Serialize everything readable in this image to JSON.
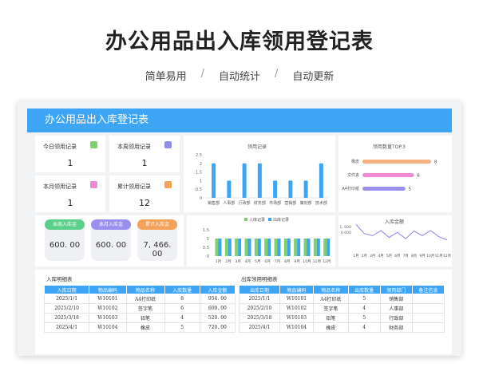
{
  "hero": {
    "title": "办公用品出入库领用登记表",
    "tags": [
      "简单易用",
      "自动统计",
      "自动更新"
    ],
    "separator": "/"
  },
  "sheet": {
    "banner_title": "办公用品出入库登记表",
    "kpis": [
      {
        "label": "今日领用记录",
        "value": "1",
        "icon_color": "#7ed16b",
        "icon": "calendar-icon"
      },
      {
        "label": "本周领用记录",
        "value": "1",
        "icon_color": "#8f8fe8",
        "icon": "document-icon"
      },
      {
        "label": "本月领用记录",
        "value": "1",
        "icon_color": "#f08ad4",
        "icon": "clock-icon"
      },
      {
        "label": "累计领用记录",
        "value": "12",
        "icon_color": "#f4a15a",
        "icon": "folder-icon"
      }
    ],
    "amounts": [
      {
        "label": "本周入库金",
        "value": "600. 00",
        "color": "#5bd08a"
      },
      {
        "label": "本月入库金",
        "value": "600. 00",
        "color": "#9b8ff0"
      },
      {
        "label": "累计入库金",
        "value": "7, 466. 00",
        "color": "#f4a15a"
      }
    ],
    "inbound_table": {
      "title": "入库明细表",
      "headers": [
        "入库日期",
        "物品编码",
        "物品名称",
        "入库数量",
        "入库金额"
      ],
      "rows": [
        [
          "2025/1/1",
          "W10101",
          "A4打印纸",
          "8",
          "954. 00"
        ],
        [
          "2025/2/10",
          "W10102",
          "签字笔",
          "6",
          "600. 00"
        ],
        [
          "2025/3/18",
          "W10103",
          "铅笔",
          "4",
          "520. 00"
        ],
        [
          "2025/4/1",
          "W10104",
          "橡皮",
          "5",
          "720. 00"
        ]
      ]
    },
    "outbound_table": {
      "title": "出库领用明细表",
      "headers": [
        "出库日期",
        "物品编码",
        "物品名称",
        "出库数量",
        "领用部门",
        "备注信息"
      ],
      "rows": [
        [
          "2025/1/1",
          "W10101",
          "A4打印纸",
          "5",
          "销售部",
          ""
        ],
        [
          "2025/2/10",
          "W10102",
          "签字笔",
          "4",
          "人事部",
          ""
        ],
        [
          "2025/3/18",
          "W10103",
          "铅笔",
          "5",
          "行政部",
          ""
        ],
        [
          "2025/4/1",
          "W10104",
          "橡皮",
          "4",
          "财务部",
          ""
        ]
      ]
    }
  },
  "chart_data": [
    {
      "type": "bar",
      "title": "领用记录",
      "categories": [
        "销售部",
        "人事部",
        "行政部",
        "财务部",
        "市场部",
        "营销部",
        "策划部",
        "技术部"
      ],
      "values": [
        2,
        1,
        2,
        2,
        1,
        1,
        1,
        2
      ],
      "ylim": [
        0,
        2.5
      ],
      "yticks": [
        "0",
        "0.5",
        "1",
        "1.5",
        "2",
        "2.5"
      ],
      "color": "#3ea4f4"
    },
    {
      "type": "bar",
      "orientation": "horizontal",
      "title": "领用数量TOP.3",
      "categories": [
        "橡皮",
        "文件夹",
        "A4打印纸"
      ],
      "values": [
        8,
        6,
        5
      ],
      "colors": [
        "#f4b080",
        "#f08ad4",
        "#9b8ff0"
      ]
    },
    {
      "type": "bar",
      "title": "",
      "series": [
        {
          "name": "入库记录",
          "values": [
            1,
            1,
            1,
            1,
            1,
            1,
            1,
            1,
            1,
            1,
            1,
            1
          ],
          "color": "#7ed16b"
        },
        {
          "name": "出库记录",
          "values": [
            1,
            1,
            1,
            1,
            1,
            1,
            1,
            1,
            1,
            1,
            1,
            1
          ],
          "color": "#3ea4f4"
        }
      ],
      "categories": [
        "1月",
        "2月",
        "3月",
        "4月",
        "5月",
        "6月",
        "7月",
        "8月",
        "9月",
        "10月",
        "11月",
        "12月"
      ],
      "ylim": [
        0,
        1.5
      ],
      "yticks": [
        "0",
        "0.5",
        "1",
        "1.5"
      ],
      "legend": "top"
    },
    {
      "type": "line",
      "title": "入库金额",
      "categories": [
        "1月",
        "2月",
        "3月",
        "4月",
        "5月",
        "6月",
        "7月",
        "8月",
        "9月",
        "10月",
        "11月",
        "12月"
      ],
      "values": [
        954,
        600,
        520,
        720,
        450,
        650,
        400,
        700,
        520,
        720,
        480,
        350
      ],
      "ylim": [
        0,
        1000
      ],
      "yticks": [
        "0.000",
        "1, 000"
      ],
      "color": "#8a7ff0"
    }
  ]
}
